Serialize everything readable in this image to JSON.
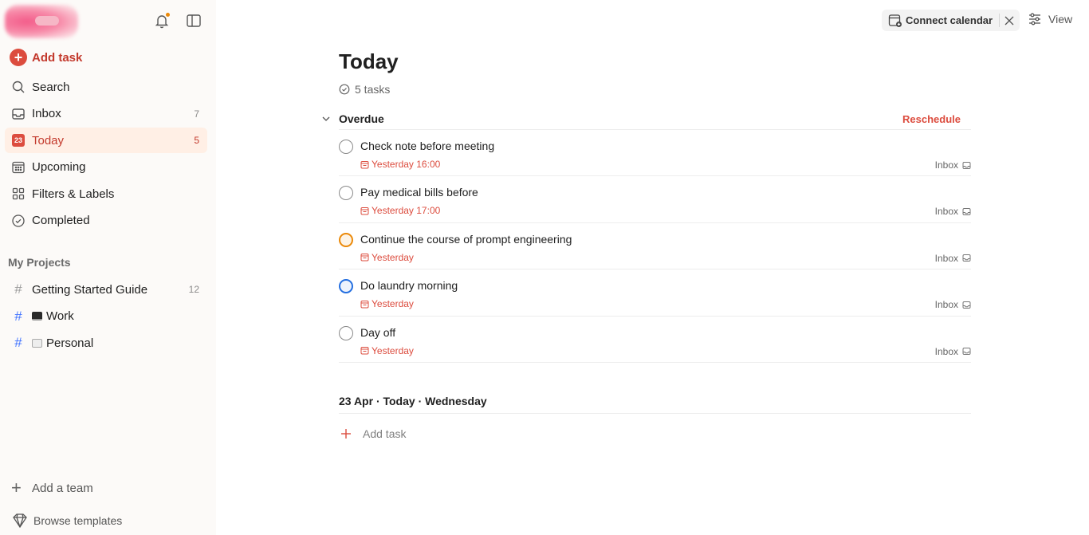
{
  "sidebar": {
    "add_task_label": "Add task",
    "nav": [
      {
        "label": "Search",
        "icon": "search-icon",
        "count": ""
      },
      {
        "label": "Inbox",
        "icon": "inbox-icon",
        "count": "7"
      },
      {
        "label": "Today",
        "icon": "today-calendar-icon",
        "count": "5",
        "day": "23"
      },
      {
        "label": "Upcoming",
        "icon": "upcoming-calendar-icon",
        "count": ""
      },
      {
        "label": "Filters & Labels",
        "icon": "filters-grid-icon",
        "count": ""
      },
      {
        "label": "Completed",
        "icon": "check-circle-icon",
        "count": ""
      }
    ],
    "projects_heading": "My Projects",
    "projects": [
      {
        "label": "Getting Started Guide",
        "count": "12"
      },
      {
        "label": "Work",
        "count": ""
      },
      {
        "label": "Personal",
        "count": ""
      }
    ],
    "add_team_label": "Add a team",
    "browse_templates_label": "Browse templates"
  },
  "header": {
    "connect_calendar_label": "Connect calendar",
    "view_label": "View"
  },
  "main": {
    "title": "Today",
    "task_count": "5 tasks",
    "overdue": {
      "title": "Overdue",
      "reschedule_label": "Reschedule",
      "tasks": [
        {
          "name": "Check note before meeting",
          "due": "Yesterday 16:00",
          "project": "Inbox",
          "priority_color": "#8a8a8a"
        },
        {
          "name": "Pay medical bills before",
          "due": "Yesterday 17:00",
          "project": "Inbox",
          "priority_color": "#8a8a8a"
        },
        {
          "name": "Continue the course of prompt engineering",
          "due": "Yesterday",
          "project": "Inbox",
          "priority_color": "#eb8909"
        },
        {
          "name": "Do laundry morning",
          "due": "Yesterday",
          "project": "Inbox",
          "priority_color": "#246fe0"
        },
        {
          "name": "Day off",
          "due": "Yesterday",
          "project": "Inbox",
          "priority_color": "#8a8a8a"
        }
      ]
    },
    "date_heading": "23 Apr · Today · Wednesday",
    "add_task_label": "Add task"
  },
  "colors": {
    "accent": "#dc4c3e",
    "sidebar_bg": "#fcfaf8",
    "active_bg": "#ffefe5"
  }
}
